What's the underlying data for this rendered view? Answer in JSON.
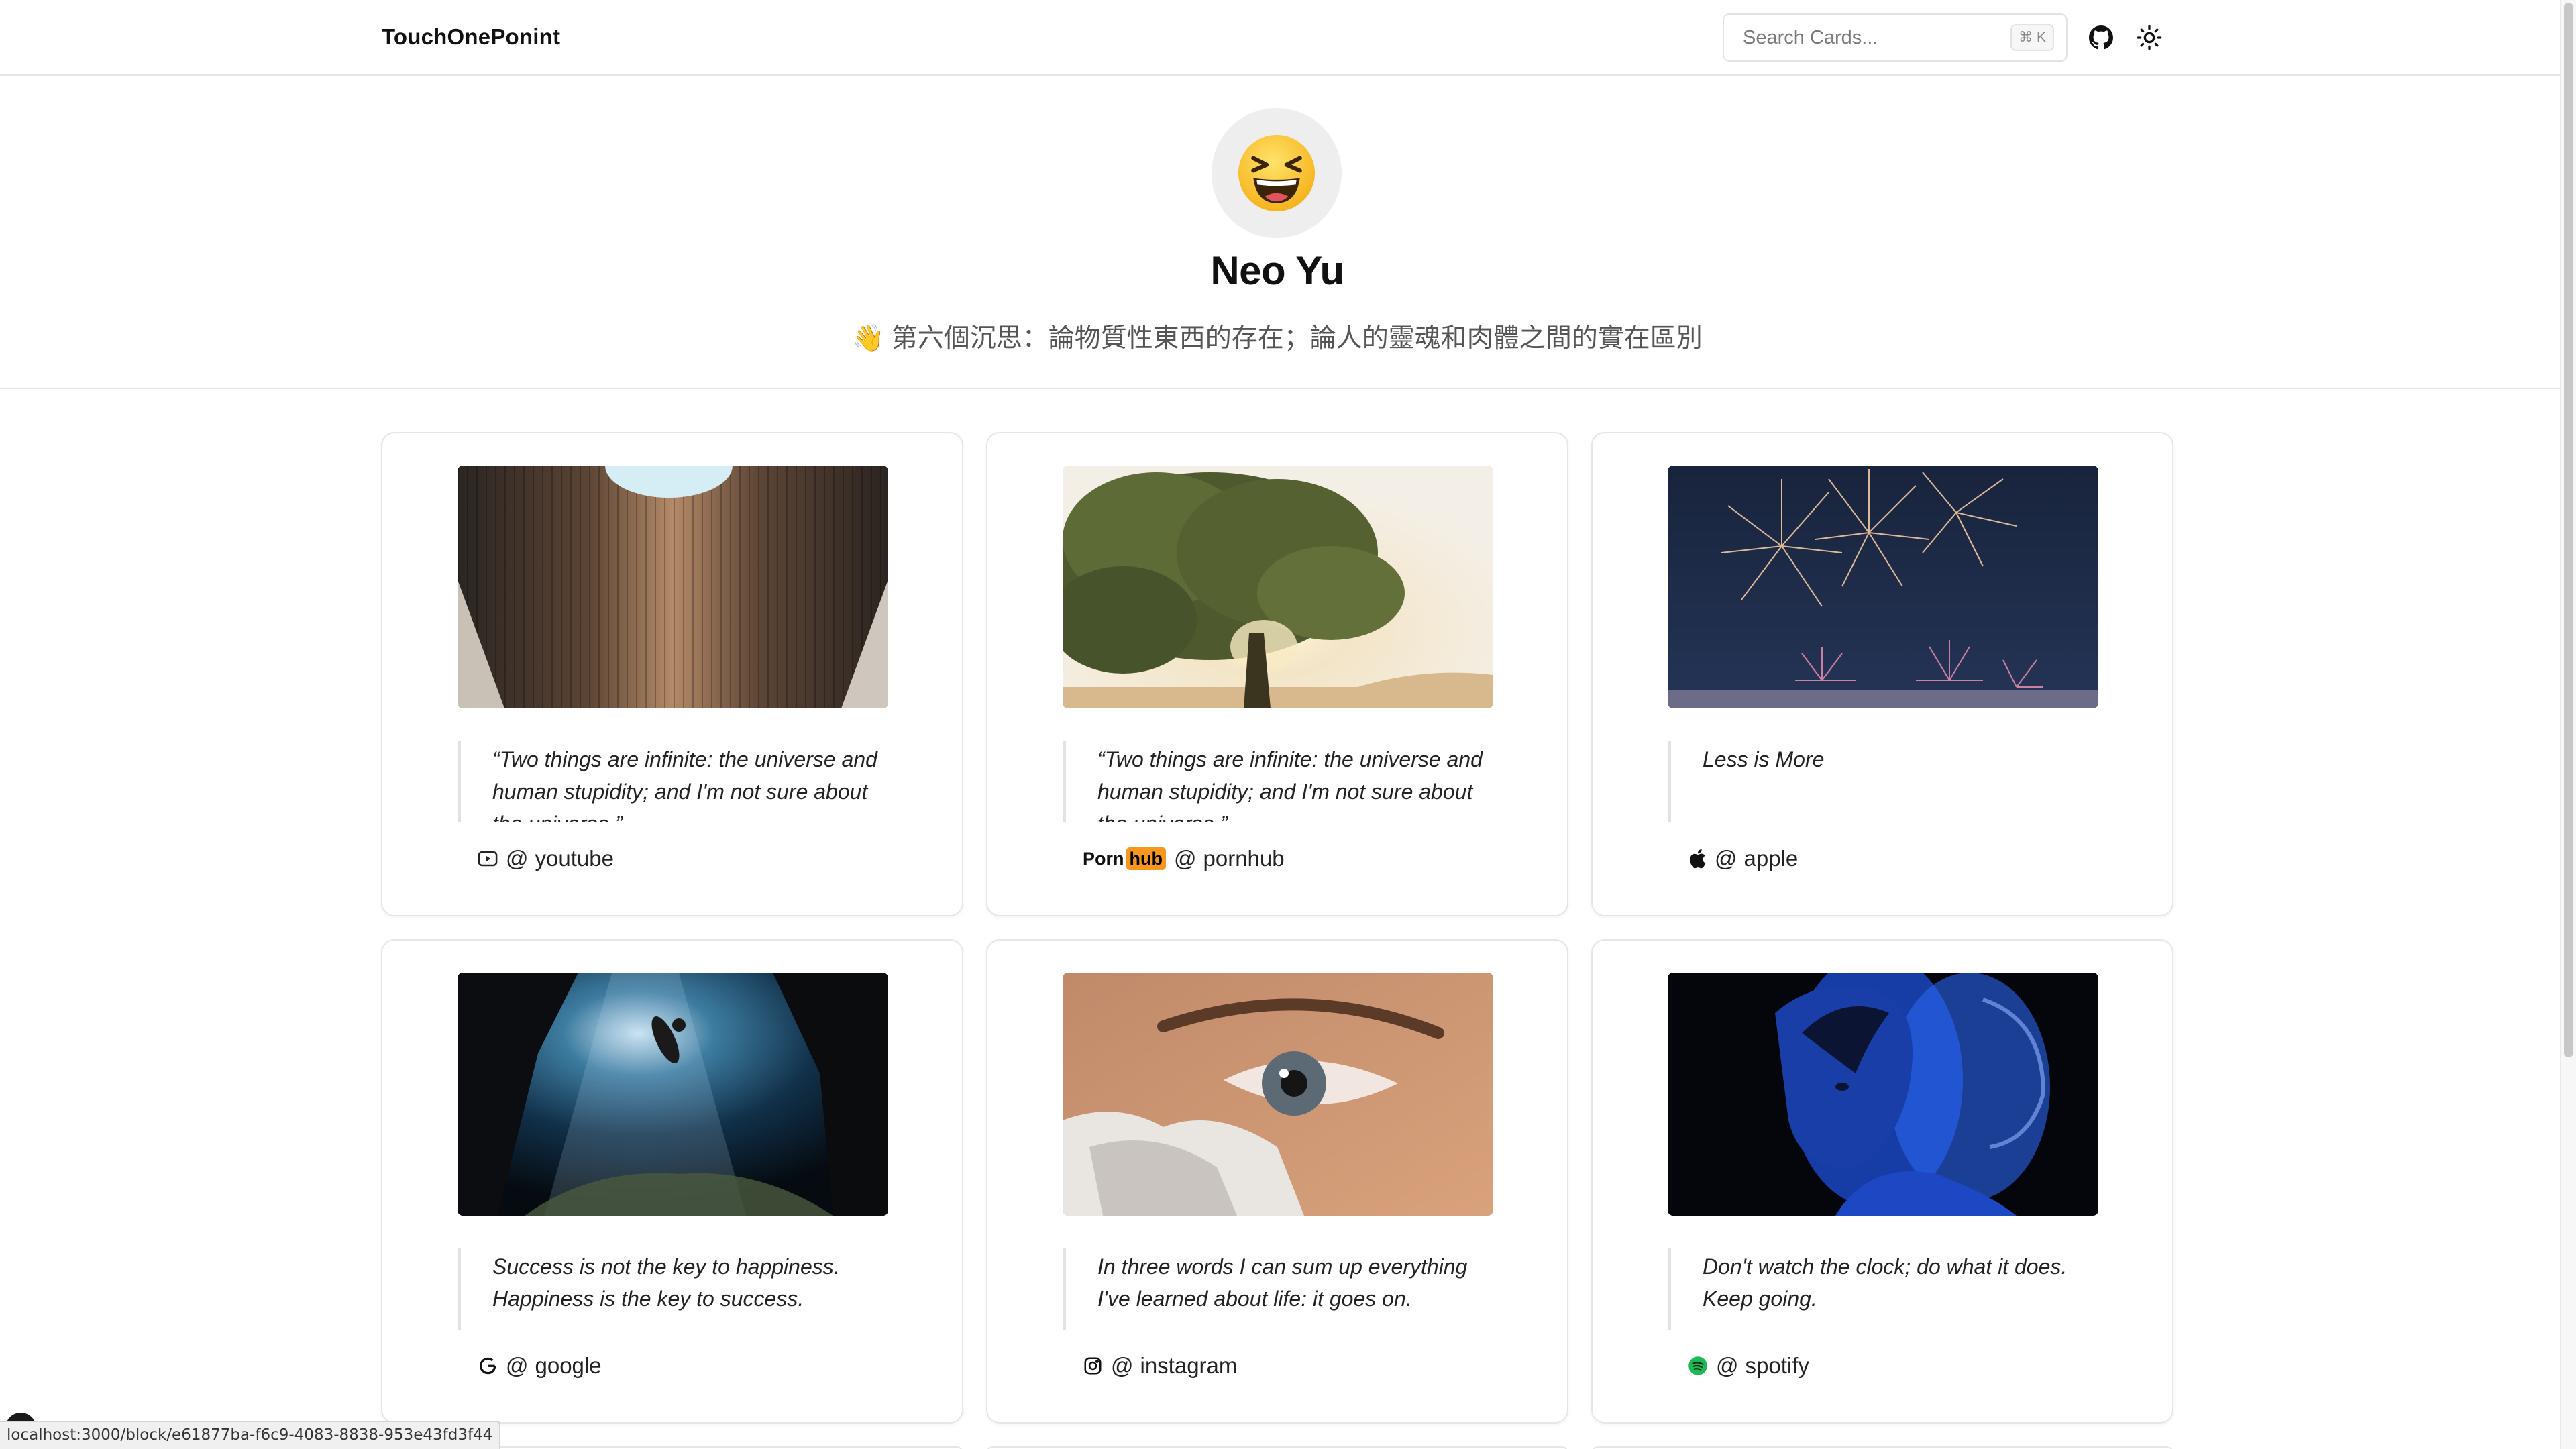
{
  "header": {
    "brand": "TouchOnePonint",
    "search_placeholder": "Search Cards...",
    "shortcut": "⌘ K",
    "github_icon": "github-icon",
    "theme_icon": "sun-icon"
  },
  "profile": {
    "avatar_emoji": "😆",
    "name": "Neo Yu",
    "bio_emoji": "👋",
    "bio": "第六個沉思：論物質性東西的存在；論人的靈魂和肉體之間的實在區別"
  },
  "cards": [
    {
      "image": "architecture-skylight-photo",
      "quote": "“Two things are infinite: the universe and human stupidity; and I'm not sure about the universe.”—",
      "platform": "youtube",
      "icon": "youtube-icon"
    },
    {
      "image": "tree-sunset-photo",
      "quote": "“Two things are infinite: the universe and human stupidity; and I'm not sure about the universe.”—",
      "platform": "pornhub",
      "logo_text_1": "Porn",
      "logo_text_2": "hub"
    },
    {
      "image": "fireworks-photo",
      "quote": "Less is More",
      "platform": "apple",
      "icon": "apple-icon"
    },
    {
      "image": "underwater-cave-diver-photo",
      "quote": "Success is not the key to happiness. Happiness is the key to success.",
      "platform": "google",
      "icon": "google-icon"
    },
    {
      "image": "eye-closeup-photo",
      "quote": "In three words I can sum up everything I've learned about life: it goes on.",
      "platform": "instagram",
      "icon": "instagram-icon"
    },
    {
      "image": "blue-portrait-photo",
      "quote": "Don't watch the clock; do what it does. Keep going.",
      "platform": "spotify",
      "icon": "spotify-icon"
    }
  ],
  "prefix": "@ ",
  "status_url": "localhost:3000/block/e61877ba-f6c9-4083-8838-953e43fd3f44",
  "colors": {
    "pornhub_orange": "#f7971d",
    "spotify_green": "#1db954",
    "border": "#e6e6e6"
  }
}
